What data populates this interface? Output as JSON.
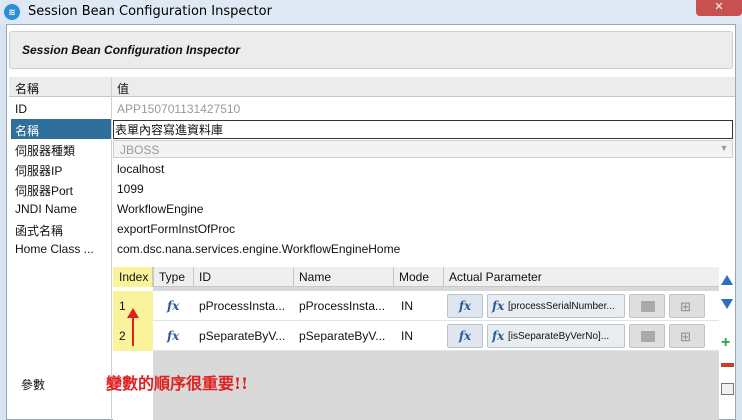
{
  "window": {
    "title": "Session Bean Configuration Inspector",
    "close_label": "✕"
  },
  "header": {
    "title": "Session Bean Configuration Inspector"
  },
  "grid": {
    "col_name": "名稱",
    "col_value": "值",
    "rows": [
      {
        "key": "ID",
        "value": "APP150701131427510"
      },
      {
        "key": "名稱",
        "value": "表單內容寫進資料庫"
      },
      {
        "key": "伺服器種類",
        "value": "JBOSS"
      },
      {
        "key": "伺服器IP",
        "value": "localhost"
      },
      {
        "key": "伺服器Port",
        "value": "1099"
      },
      {
        "key": "JNDI Name",
        "value": "WorkflowEngine"
      },
      {
        "key": "函式名稱",
        "value": "exportFormInstOfProc"
      },
      {
        "key": "Home Class ...",
        "value": "com.dsc.nana.services.engine.WorkflowEngineHome"
      },
      {
        "key": "參數",
        "value": ""
      }
    ]
  },
  "params": {
    "headers": {
      "index": "Index",
      "type": "Type",
      "id": "ID",
      "name": "Name",
      "mode": "Mode",
      "actual": "Actual Parameter"
    },
    "rows": [
      {
        "index": "1",
        "type": "fx",
        "id": "pProcessInsta...",
        "name": "pProcessInsta...",
        "mode": "IN",
        "actual": "[processSerialNumber..."
      },
      {
        "index": "2",
        "type": "fx",
        "id": "pSeparateByV...",
        "name": "pSeparateByV...",
        "mode": "IN",
        "actual": "[isSeparateByVerNo]..."
      }
    ]
  },
  "annotation": {
    "text": "變數的順序很重要!!"
  },
  "colors": {
    "selection": "#2f6f9c",
    "index_highlight": "#fbf39b",
    "annotation": "#e02020"
  }
}
